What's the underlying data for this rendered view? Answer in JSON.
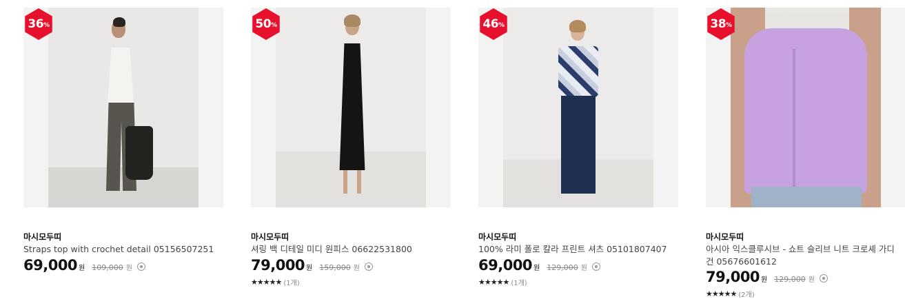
{
  "products": [
    {
      "badge": "36",
      "badge_suffix": "%",
      "brand": "마시모두띠",
      "name": "Straps top with crochet detail 05156507251",
      "price": "69,000",
      "currency": "원",
      "original_price": "109,000",
      "original_currency": "원"
    },
    {
      "badge": "50",
      "badge_suffix": "%",
      "brand": "마시모두띠",
      "name": "셔링 백 디테일 미디 원피스 06622531800",
      "price": "79,000",
      "currency": "원",
      "original_price": "159,000",
      "original_currency": "원",
      "stars": "★★★★★",
      "review_count": "(1개)"
    },
    {
      "badge": "46",
      "badge_suffix": "%",
      "brand": "마시모두띠",
      "name": "100% 라미 폴로 칼라 프린트 셔츠 05101807407",
      "price": "69,000",
      "currency": "원",
      "original_price": "129,000",
      "original_currency": "원",
      "stars": "★★★★★",
      "review_count": "(1개)"
    },
    {
      "badge": "38",
      "badge_suffix": "%",
      "brand": "마시모두띠",
      "name": "아시아 익스클루시브 - 쇼트 슬리브 니트 크로셰 가디건 05676601612",
      "price": "79,000",
      "currency": "원",
      "original_price": "129,000",
      "original_currency": "원",
      "stars": "★★★★★",
      "review_count": "(2개)"
    }
  ],
  "colors": {
    "badge": "#e8112d",
    "cardigan": "#c6a3e0",
    "skirt": "#1f2f4f"
  }
}
